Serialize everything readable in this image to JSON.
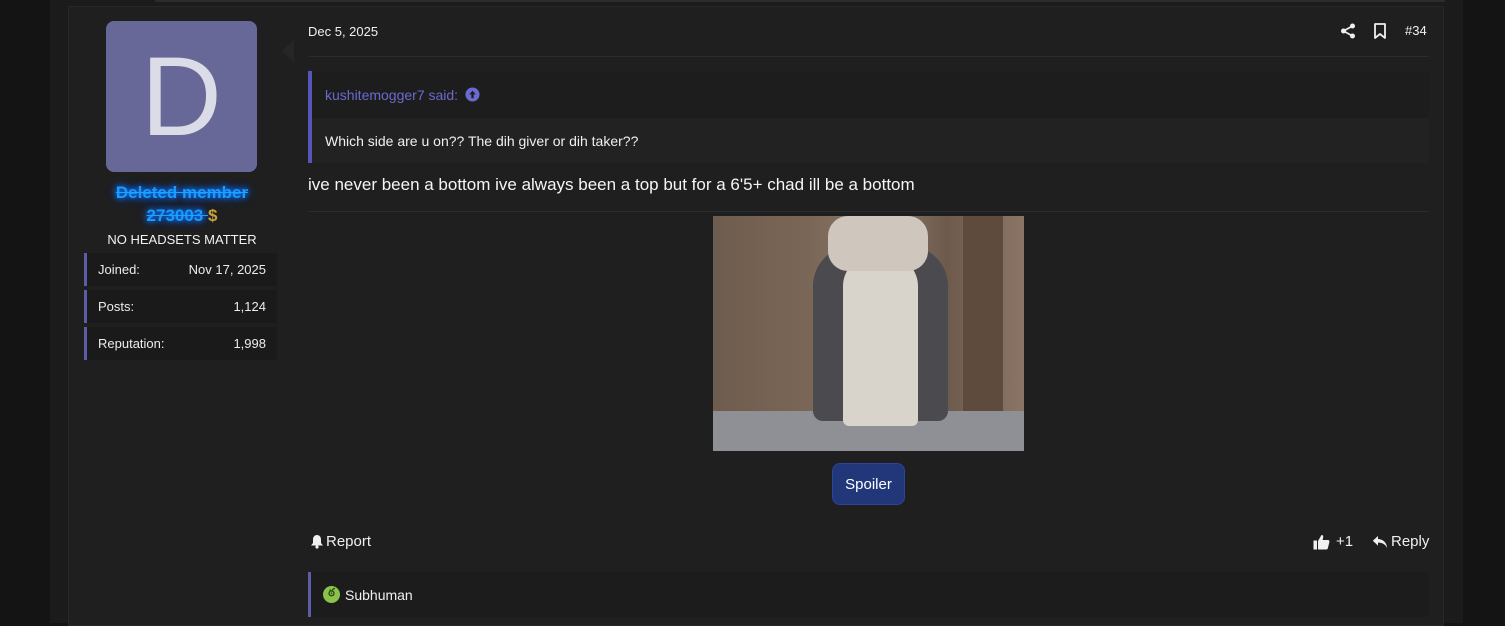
{
  "post": {
    "date": "Dec 5, 2025",
    "number": "#34",
    "message": "ive never been a bottom ive always been a top but for a 6'5+ chad ill be a bottom",
    "spoiler_label": "Spoiler"
  },
  "user": {
    "avatar_letter": "D",
    "avatar_color": "#686898",
    "name_line1": "Deleted member",
    "name_line2": "273003",
    "title": "NO HEADSETS MATTER",
    "stats": [
      {
        "label": "Joined:",
        "value": "Nov 17, 2025"
      },
      {
        "label": "Posts:",
        "value": "1,124"
      },
      {
        "label": "Reputation:",
        "value": "1,998"
      }
    ]
  },
  "quote": {
    "author": "kushitemogger7 said:",
    "text": "Which side are u on?? The dih giver or dih taker??"
  },
  "actions": {
    "report": "Report",
    "like_count": "+1",
    "reply": "Reply"
  },
  "reactions": {
    "label": "Subhuman",
    "icon": "sick-face-icon"
  },
  "colors": {
    "accent": "#5c5ca8",
    "username": "#1aa3ff",
    "spoiler_button": "#22367a"
  }
}
